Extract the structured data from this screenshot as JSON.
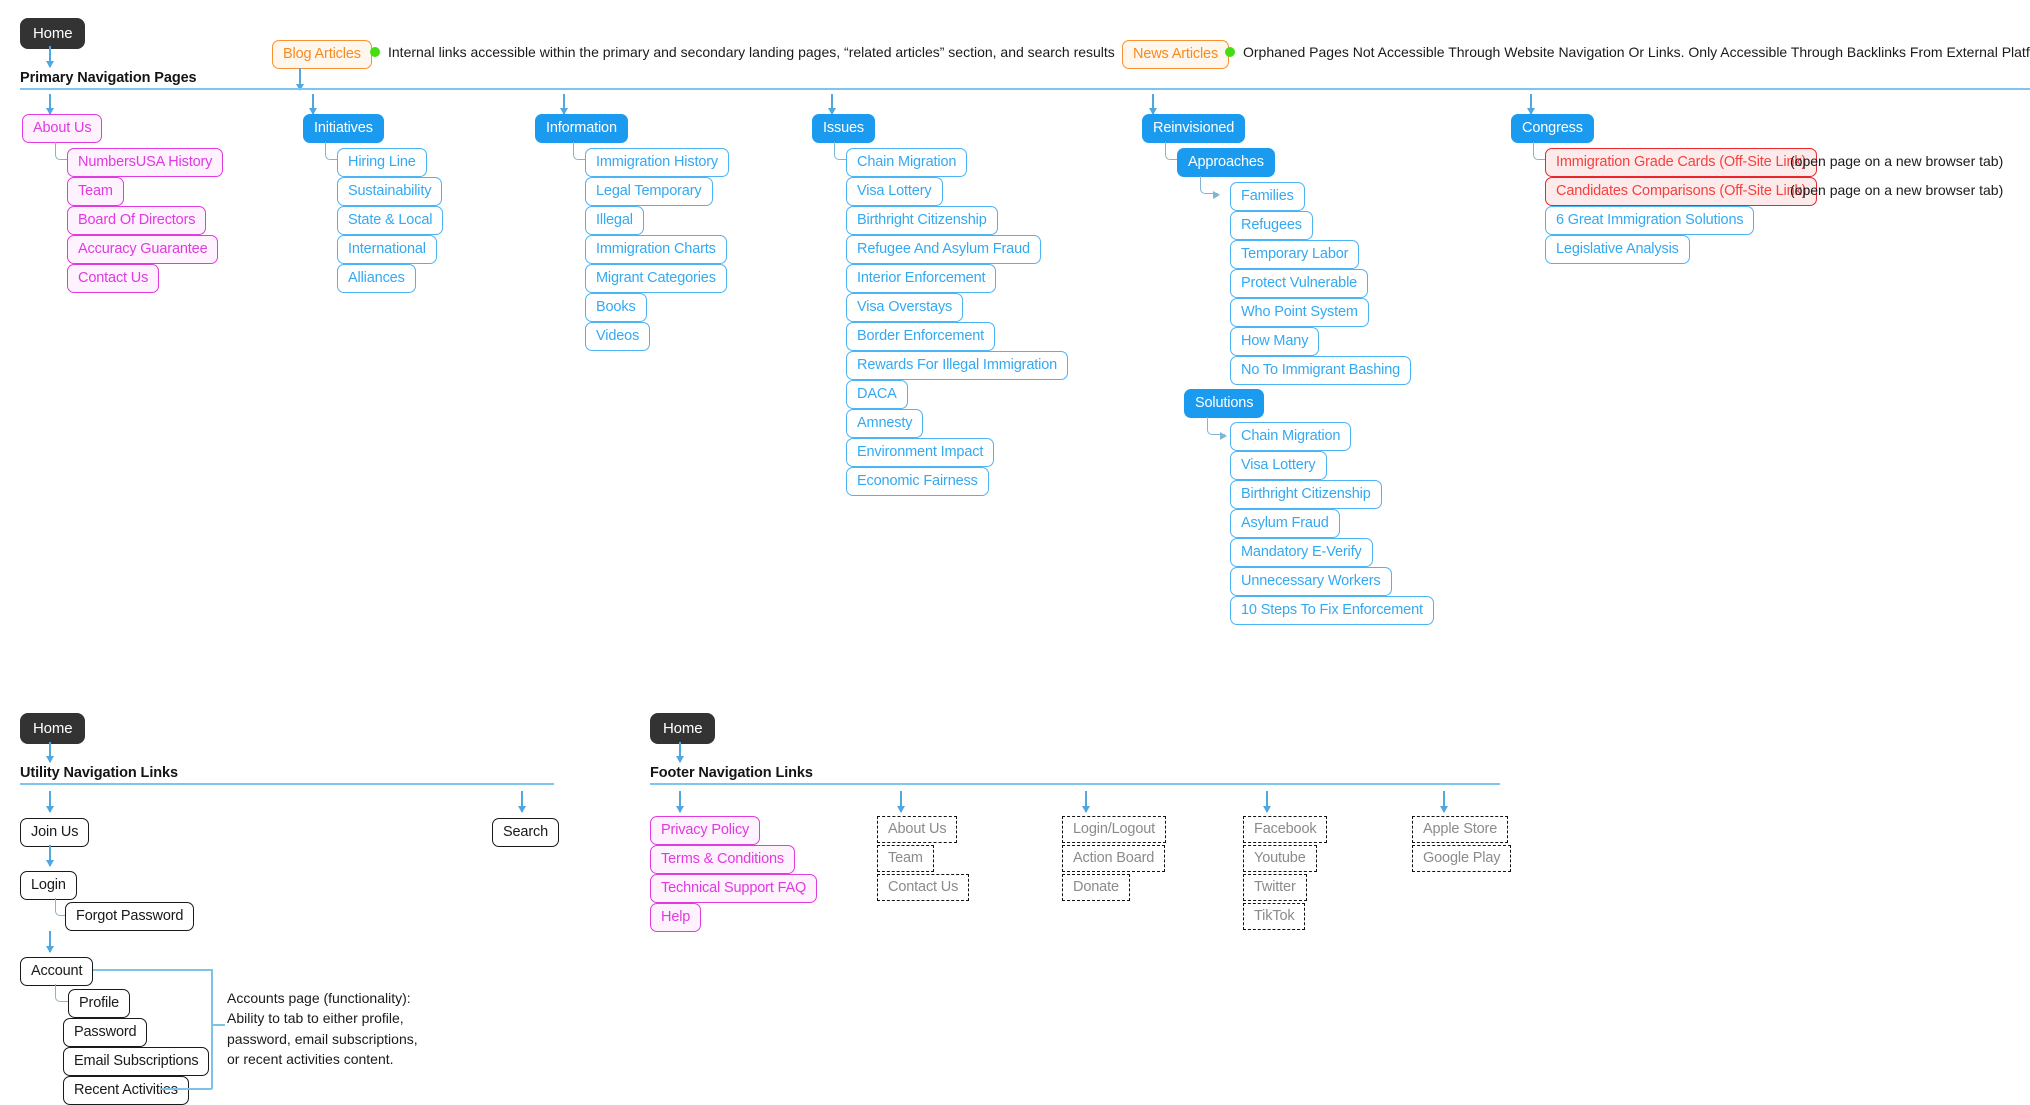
{
  "colors": {
    "primary_blue": "#1a9bf0",
    "child_blue": "#4bb4f5",
    "magenta": "#e13ae1",
    "red": "#e8262b",
    "orange": "#f79134",
    "legend_dot_green": "#44dd11",
    "connector_blue": "#4fa8e0",
    "home_dark": "#333333",
    "dashed_grey": "#8b8b8b"
  },
  "home_top": {
    "label": "Home"
  },
  "legend": [
    {
      "chip": "Blog Articles",
      "dot": "green-dot-icon",
      "text": "Internal links accessible within the primary and secondary landing pages, “related articles” section, and search results"
    },
    {
      "chip": "News Articles",
      "dot": "green-dot-icon",
      "text": "Orphaned Pages Not Accessible Through Website Navigation Or Links. Only Accessible Through Backlinks From External Platforms Or Websites."
    }
  ],
  "primary": {
    "section_title": "Primary Navigation Pages",
    "columns": [
      {
        "name": "about-us",
        "root": "About Us",
        "style": "pink",
        "children": [
          "NumbersUSA History",
          "Team",
          "Board Of Directors",
          "Accuracy Guarantee",
          "Contact Us"
        ]
      },
      {
        "name": "initiatives",
        "root": "Initiatives",
        "style": "blue",
        "children": [
          "Hiring Line",
          "Sustainability",
          "State & Local",
          "International",
          "Alliances"
        ]
      },
      {
        "name": "information",
        "root": "Information",
        "style": "blue",
        "children": [
          "Immigration History",
          "Legal Temporary",
          "Illegal",
          "Immigration Charts",
          "Migrant Categories",
          "Books",
          "Videos"
        ]
      },
      {
        "name": "issues",
        "root": "Issues",
        "style": "blue",
        "children": [
          "Chain Migration",
          "Visa Lottery",
          "Birthright Citizenship",
          "Refugee And Asylum Fraud",
          "Interior Enforcement",
          "Visa Overstays",
          "Border Enforcement",
          "Rewards For Illegal Immigration",
          "DACA",
          "Amnesty",
          "Environment Impact",
          "Economic Fairness"
        ]
      },
      {
        "name": "reinvisioned",
        "root": "Reinvisioned",
        "style": "blue",
        "sub_root_a": "Approaches",
        "children": [
          "Families",
          "Refugees",
          "Temporary Labor",
          "Protect Vulnerable",
          "Who Point System",
          "How Many",
          "No To Immigrant Bashing"
        ],
        "sub_root_b": "Solutions",
        "children_b": [
          "Chain Migration",
          "Visa Lottery",
          "Birthright Citizenship",
          "Asylum Fraud",
          "Mandatory E-Verify",
          "Unnecessary Workers",
          "10 Steps To Fix Enforcement"
        ]
      },
      {
        "name": "congress",
        "root": "Congress",
        "style": "blue",
        "children": [
          "Immigration Grade Cards (Off-Site Link)",
          "Candidates Comparisons (Off-Site Link)",
          "6 Great Immigration Solutions",
          "Legislative Analysis"
        ],
        "child_styles": [
          "red",
          "red",
          "blue",
          "blue"
        ],
        "notes": [
          "(open page on a new browser tab)",
          "(open page on a new browser tab)"
        ]
      }
    ]
  },
  "utility": {
    "home_label": "Home",
    "section_title": "Utility Navigation Links",
    "join_us": "Join Us",
    "login": "Login",
    "forgot_password": "Forgot Password",
    "account": "Account",
    "account_children": [
      "Profile",
      "Password",
      "Email Subscriptions",
      "Recent Activities"
    ],
    "search": "Search",
    "account_note": "Accounts page (functionality):\nAbility to tab to either profile,\npassword, email subscriptions,\nor recent activities content."
  },
  "footer": {
    "home_label": "Home",
    "section_title": "Footer Navigation Links",
    "columns": [
      {
        "name": "legal",
        "style": "pink",
        "items": [
          "Privacy Policy",
          "Terms & Conditions",
          "Technical Support FAQ",
          "Help"
        ]
      },
      {
        "name": "company",
        "style": "dashed",
        "items": [
          "About Us",
          "Team",
          "Contact Us"
        ]
      },
      {
        "name": "account-actions",
        "style": "dashed",
        "items": [
          "Login/Logout",
          "Action Board",
          "Donate"
        ]
      },
      {
        "name": "social",
        "style": "dashed",
        "items": [
          "Facebook",
          "Youtube",
          "Twitter",
          "TikTok"
        ]
      },
      {
        "name": "app-stores",
        "style": "dashed",
        "items": [
          "Apple Store",
          "Google Play"
        ]
      }
    ]
  }
}
